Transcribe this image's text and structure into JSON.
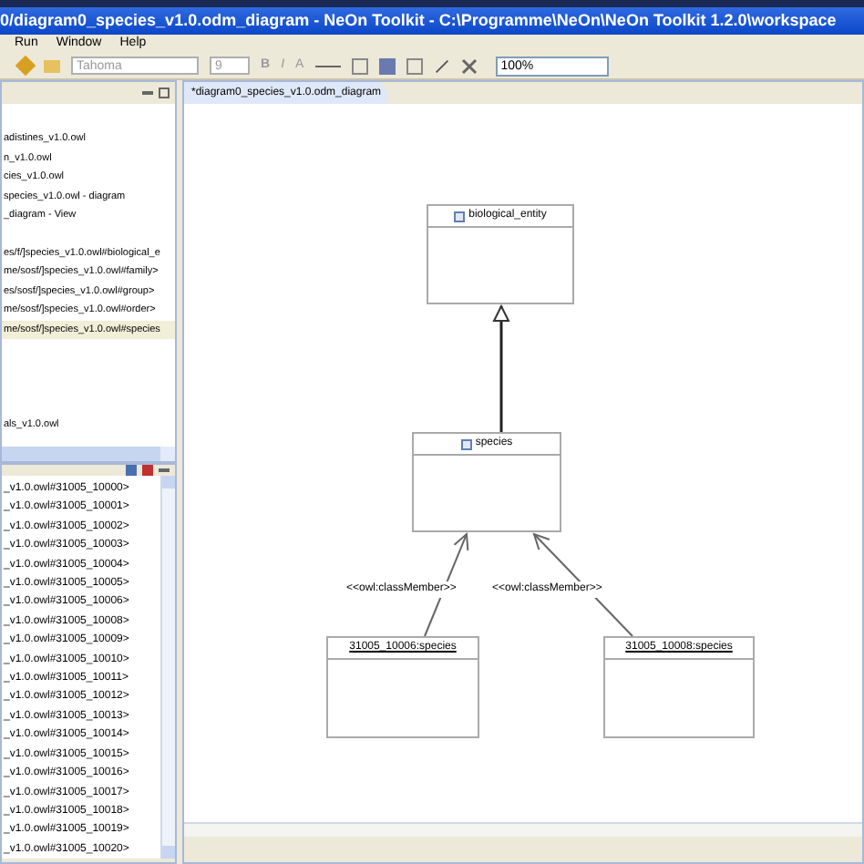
{
  "window": {
    "title": "0/diagram0_species_v1.0.odm_diagram - NeOn Toolkit - C:\\Programme\\NeOn\\NeOn Toolkit 1.2.0\\workspace"
  },
  "menu": [
    "Run",
    "Window",
    "Help"
  ],
  "toolbar": {
    "font": "Tahoma",
    "size": "9",
    "bold": "B",
    "italic": "I",
    "font_color": "A",
    "zoom": "100%"
  },
  "upper_panel": {
    "items": [
      {
        "label": "adistines_v1.0.owl",
        "selected": false
      },
      {
        "label": "n_v1.0.owl",
        "selected": false
      },
      {
        "label": "cies_v1.0.owl",
        "selected": false
      },
      {
        "label": "species_v1.0.owl - diagram",
        "selected": false
      },
      {
        "label": "_diagram - View",
        "selected": false
      },
      {
        "label": "es/f/]species_v1.0.owl#biological_e",
        "selected": false
      },
      {
        "label": "me/sosf/]species_v1.0.owl#family>",
        "selected": false
      },
      {
        "label": "es/sosf/]species_v1.0.owl#group>",
        "selected": false
      },
      {
        "label": "me/sosf/]species_v1.0.owl#order>",
        "selected": false
      },
      {
        "label": "me/sosf/]species_v1.0.owl#species",
        "selected": true
      },
      {
        "label": "als_v1.0.owl",
        "selected": false
      }
    ]
  },
  "lower_panel": {
    "items": [
      "_v1.0.owl#31005_10000>",
      "_v1.0.owl#31005_10001>",
      "_v1.0.owl#31005_10002>",
      "_v1.0.owl#31005_10003>",
      "_v1.0.owl#31005_10004>",
      "_v1.0.owl#31005_10005>",
      "_v1.0.owl#31005_10006>",
      "_v1.0.owl#31005_10008>",
      "_v1.0.owl#31005_10009>",
      "_v1.0.owl#31005_10010>",
      "_v1.0.owl#31005_10011>",
      "_v1.0.owl#31005_10012>",
      "_v1.0.owl#31005_10013>",
      "_v1.0.owl#31005_10014>",
      "_v1.0.owl#31005_10015>",
      "_v1.0.owl#31005_10016>",
      "_v1.0.owl#31005_10017>",
      "_v1.0.owl#31005_10018>",
      "_v1.0.owl#31005_10019>",
      "_v1.0.owl#31005_10020>"
    ]
  },
  "editor": {
    "tab": "*diagram0_species_v1.0.odm_diagram",
    "nodes": [
      {
        "kind": "class",
        "label": "biological_entity"
      },
      {
        "kind": "class",
        "label": "species"
      },
      {
        "kind": "instance",
        "label": "31005_10006:species"
      },
      {
        "kind": "instance",
        "label": "31005_10008:species"
      }
    ],
    "edges": [
      {
        "kind": "generalization"
      },
      {
        "kind": "association",
        "label": "<<owl:classMember>>"
      },
      {
        "kind": "association",
        "label": "<<owl:classMember>>"
      }
    ]
  }
}
